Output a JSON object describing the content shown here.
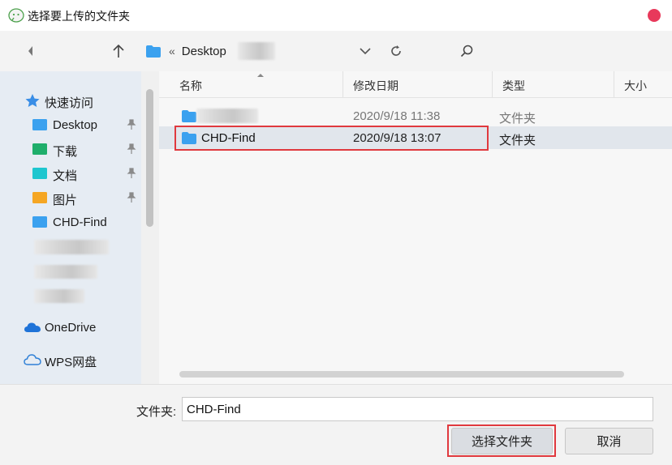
{
  "window": {
    "title": "选择要上传的文件夹",
    "close_color": "#e8395b"
  },
  "address_bar": {
    "breadcrumb_sep": "«",
    "crumb": "Desktop"
  },
  "sidebar": {
    "items": [
      {
        "label": "快速访问",
        "icon": "star-icon"
      },
      {
        "label": "Desktop",
        "icon": "folder-blue-icon",
        "pinned": true
      },
      {
        "label": "下载",
        "icon": "download-folder-icon",
        "pinned": true
      },
      {
        "label": "文档",
        "icon": "documents-folder-icon",
        "pinned": true
      },
      {
        "label": "图片",
        "icon": "pictures-folder-icon",
        "pinned": true
      },
      {
        "label": "CHD-Find",
        "icon": "folder-blue-icon"
      },
      {
        "label": "OneDrive",
        "icon": "onedrive-cloud-icon"
      },
      {
        "label": "WPS网盘",
        "icon": "wps-cloud-icon"
      }
    ]
  },
  "file_list": {
    "columns": [
      "名称",
      "修改日期",
      "类型",
      "大小"
    ],
    "rows": [
      {
        "name": "",
        "modified": "2020/9/18 11:38",
        "type": "文件夹",
        "selected": false
      },
      {
        "name": "CHD-Find",
        "modified": "2020/9/18 13:07",
        "type": "文件夹",
        "selected": true
      }
    ]
  },
  "footer": {
    "folder_label": "文件夹:",
    "folder_value": "CHD-Find",
    "select_button": "选择文件夹",
    "cancel_button": "取消"
  },
  "colors": {
    "highlight": "#e0393e",
    "folder_blue": "#3ba1ef"
  }
}
